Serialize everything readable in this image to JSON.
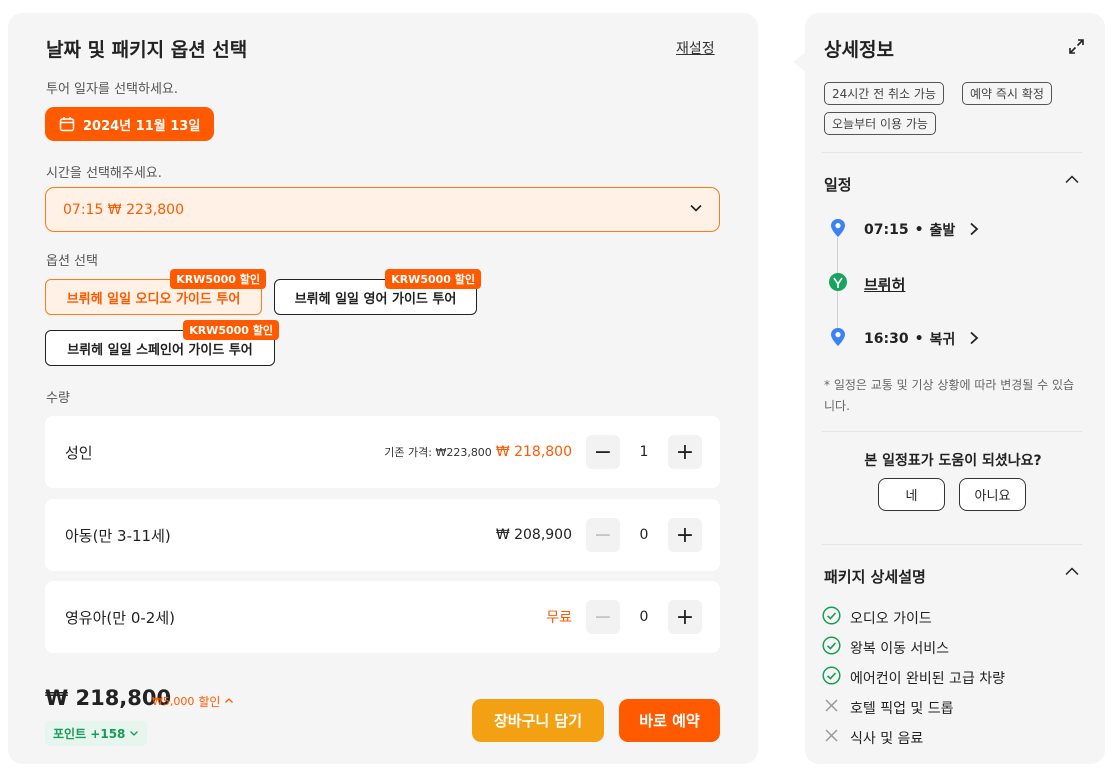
{
  "booking": {
    "title": "날짜 및 패키지 옵션 선택",
    "reset_label": "재설정",
    "date_prompt": "투어 일자를 선택하세요.",
    "selected_date": "2024년 11월 13일",
    "time_prompt": "시간을 선택해주세요.",
    "selected_time": "07:15 ₩ 223,800",
    "option_prompt": "옵션 선택",
    "options": [
      {
        "label": "브뤼헤 일일 오디오 가이드 투어",
        "badge": "KRW5000 할인",
        "selected": true
      },
      {
        "label": "브뤼헤 일일 영어 가이드 투어",
        "badge": "KRW5000 할인",
        "selected": false
      },
      {
        "label": "브뤼헤 일일 스페인어 가이드 투어",
        "badge": "KRW5000 할인",
        "selected": false
      }
    ],
    "quantity_label": "수량",
    "quantities": [
      {
        "name": "성인",
        "original_price": "기존 가격: ₩223,800",
        "price": "₩ 218,800",
        "qty": "1"
      },
      {
        "name": "아동(만 3-11세)",
        "price": "₩ 208,900",
        "qty": "0"
      },
      {
        "name": "영유아(만 0-2세)",
        "price": "무료",
        "qty": "0"
      }
    ],
    "total": "₩ 218,800",
    "discount_amount": "₩5,000",
    "discount_word": "할인",
    "points": "포인트 +158",
    "cart_label": "장바구니 담기",
    "book_label": "바로 예약"
  },
  "details": {
    "title": "상세정보",
    "tags": [
      "24시간 전 취소 가능",
      "예약 즉시 확정",
      "오늘부터 이용 가능"
    ],
    "schedule_title": "일정",
    "schedule": [
      {
        "time": "07:15",
        "label": "출발"
      },
      {
        "place": "브뤼허"
      },
      {
        "time": "16:30",
        "label": "복귀"
      }
    ],
    "schedule_note": "* 일정은 교통 및 기상 상황에 따라 변경될 수 있습니다.",
    "feedback_question": "본 일정표가 도움이 되셨나요?",
    "feedback_yes": "네",
    "feedback_no": "아니요",
    "package_title": "패키지 상세설명",
    "features": [
      {
        "label": "오디오 가이드",
        "included": true
      },
      {
        "label": "왕복 이동 서비스",
        "included": true
      },
      {
        "label": "에어컨이 완비된 고급 차량",
        "included": true
      },
      {
        "label": "호텔 픽업 및 드롭",
        "included": false
      },
      {
        "label": "식사 및 음료",
        "included": false
      }
    ]
  },
  "colors": {
    "accent": "#ff5a00",
    "cart": "#f3a012",
    "included": "#1a9c59",
    "pin": "#3b82f6"
  }
}
